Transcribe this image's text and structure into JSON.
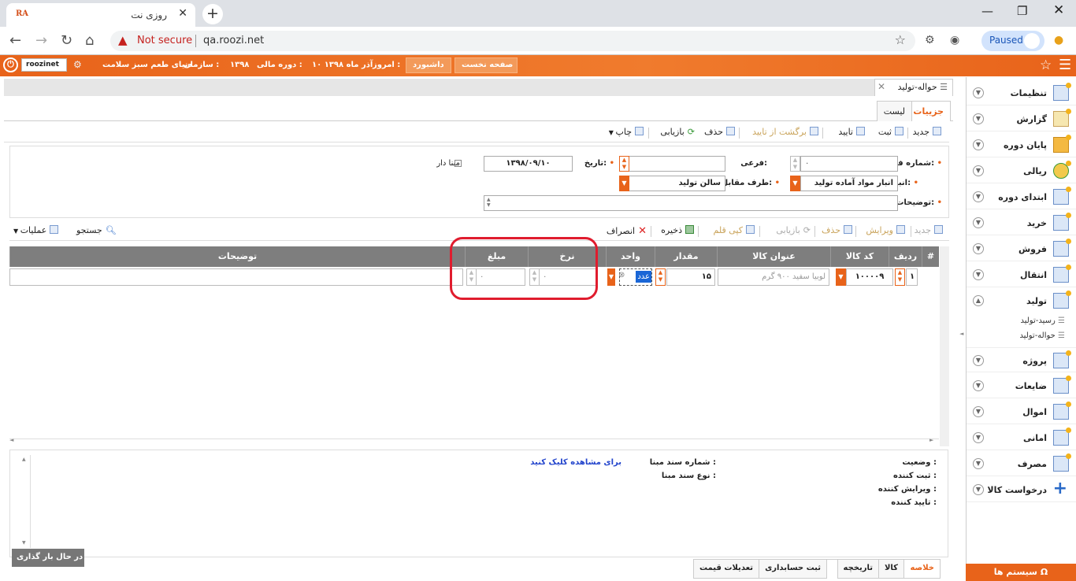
{
  "browser": {
    "tab_title": "روزی نت",
    "favicon_text": "RA",
    "not_secure": "Not secure",
    "url": "qa.roozi.net",
    "profile_status": "Paused"
  },
  "topbar": {
    "username": "roozinet",
    "org_label": "سازمان :",
    "org_value": "دنیای طعم سبز سلامت",
    "period_label": "دوره مالی :",
    "period_value": "۱۳۹۸",
    "today_label": "امروز :",
    "today_value": "۱۰ آذر ماه ۱۳۹۸",
    "dashboard_button": "داشبورد",
    "home_button": "صفحه نخست"
  },
  "document_tab": {
    "label": "حواله-تولید"
  },
  "subtabs": {
    "details": "جزییات",
    "list": "لیست"
  },
  "toolbar": {
    "new": "جدید",
    "register": "ثبت",
    "approve": "تایید",
    "unapprove": "برگشت از تایید",
    "delete": "حذف",
    "refresh": "بازیابی",
    "print": "چاپ"
  },
  "form": {
    "form_number_label": "شماره فرم:",
    "form_number_value": "۰",
    "sub_label": "فرعی:",
    "sub_value": "",
    "date_label": "تاریخ:",
    "date_value": "۱۳۹۸/۰۹/۱۰",
    "base_label": "مبنا دار",
    "warehouse_label": "انبار:",
    "warehouse_value": "انبار مواد آماده تولید",
    "counterparty_label": "طرف مقابل:",
    "counterparty_value": "سالن تولید",
    "description_label": "توضیحات:",
    "description_value": ""
  },
  "grid_toolbar": {
    "new": "جدید",
    "edit": "ویرایش",
    "delete": "حذف",
    "refresh": "بازیابی",
    "copy_item": "کپی قلم",
    "save": "ذخیره",
    "cancel": "انصراف",
    "search": "جستجو",
    "operations": "عملیات"
  },
  "grid": {
    "headers": {
      "hash": "#",
      "row": "ردیف",
      "code": "کد کالا",
      "title": "عنوان کالا",
      "qty": "مقدار",
      "unit": "واحد",
      "rate": "نرخ",
      "amount": "مبلغ",
      "desc": "توضیحات"
    },
    "rows": [
      {
        "row": "۱",
        "code": "۱۰۰۰۰۹",
        "title": "لوبیا سفید ۹۰۰ گرم",
        "qty": "۱۵",
        "unit": "عدد",
        "rate": "۰",
        "amount": "۰",
        "desc": ""
      }
    ]
  },
  "info": {
    "status_label": "وضعیت :",
    "registrar_label": "ثبت کننده :",
    "editor_label": "ویرایش کننده :",
    "approver_label": "تایید کننده :",
    "base_doc_number_label": "شماره سند مبنا :",
    "base_doc_type_label": "نوع سند مبنا :",
    "view_link": "برای مشاهده کلیک کنید"
  },
  "loading_text": "در حال بار گذاری ...",
  "bottom_tabs": {
    "summary": "خلاصه",
    "goods": "کالا",
    "history": "تاریخچه",
    "accounting": "ثبت حسابداری",
    "price_adj": "تعدیلات قیمت"
  },
  "sidebar": {
    "items": [
      "تنظیمات",
      "گزارش",
      "پایان دوره",
      "ریالی",
      "ابتدای دوره",
      "خرید",
      "فروش",
      "انتقال",
      "تولید",
      "پروژه",
      "ضایعات",
      "اموال",
      "امانی",
      "مصرف",
      "درخواست کالا"
    ],
    "sub_items": [
      "رسید-تولید",
      "حواله-تولید"
    ],
    "system_button": "سیستم ها"
  },
  "colors": {
    "accent": "#e8631a",
    "highlight": "#e01c2e",
    "header": "#7e7e7e",
    "link": "#2244cc"
  }
}
